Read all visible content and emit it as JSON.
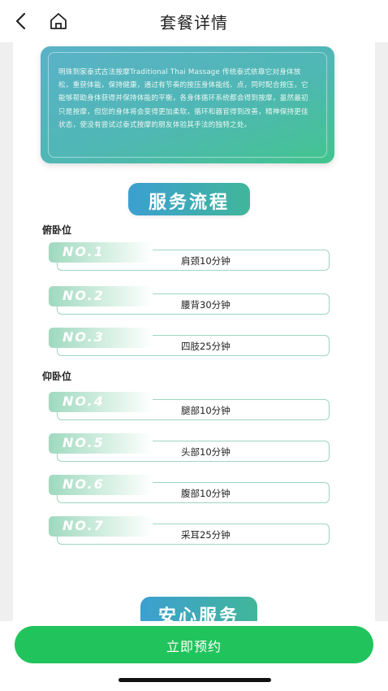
{
  "header": {
    "title": "套餐详情"
  },
  "intro": {
    "text": "明珠到家泰式古法按摩Traditional Thai Massage 传统泰式依靠它对身体放松，重获体能，保持健康，通过有节奏的按压身体能线、点，同时配合按压，它能够帮助身体获得并保持体能的平衡，各身体循环系统都会得到按摩，虽然最初只是按摩，但您的身体将会变得更加柔软，循环和器官得到改善，精神保持更佳状态，使没有尝试过泰式按摩的朋友体验其手法的独特之处。"
  },
  "service_flow": {
    "title": "服务流程",
    "groups": [
      {
        "label": "俯卧位",
        "steps": [
          {
            "no": "NO.1",
            "text": "肩颈10分钟"
          },
          {
            "no": "NO.2",
            "text": "腰背30分钟"
          },
          {
            "no": "NO.3",
            "text": "四肢25分钟"
          }
        ]
      },
      {
        "label": "仰卧位",
        "steps": [
          {
            "no": "NO.4",
            "text": "腿部10分钟"
          },
          {
            "no": "NO.5",
            "text": "头部10分钟"
          },
          {
            "no": "NO.6",
            "text": "腹部10分钟"
          },
          {
            "no": "NO.7",
            "text": "采耳25分钟"
          }
        ]
      }
    ]
  },
  "safety_section": {
    "title": "安心服务"
  },
  "cta": {
    "label": "立即预约"
  },
  "colors": {
    "accent_green": "#21c45c",
    "heading_blue": "#3c9fd1",
    "heading_teal": "#41b69a"
  }
}
